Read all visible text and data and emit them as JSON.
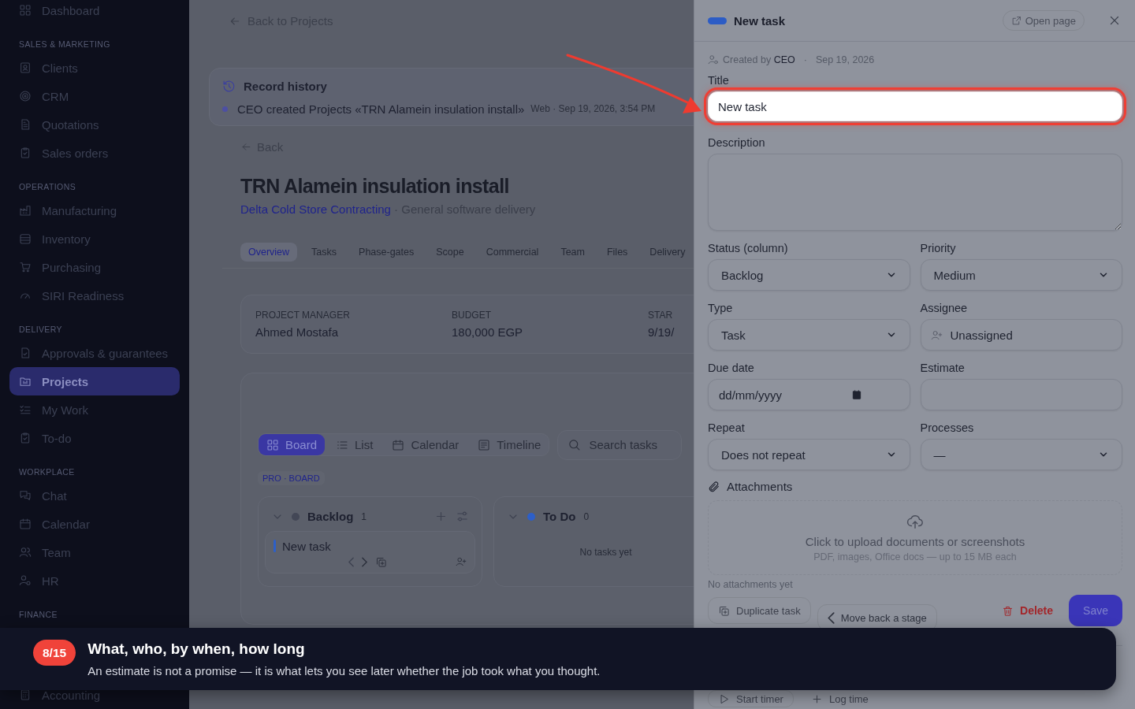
{
  "sidebar": {
    "sections": [
      {
        "items": [
          {
            "label": "Dashboard",
            "selected": false
          }
        ]
      },
      {
        "heading": "SALES & MARKETING",
        "items": [
          {
            "label": "Clients",
            "selected": false
          },
          {
            "label": "CRM",
            "selected": false
          },
          {
            "label": "Quotations",
            "selected": false
          },
          {
            "label": "Sales orders",
            "selected": false
          }
        ]
      },
      {
        "heading": "OPERATIONS",
        "items": [
          {
            "label": "Manufacturing",
            "selected": false
          },
          {
            "label": "Inventory",
            "selected": false
          },
          {
            "label": "Purchasing",
            "selected": false
          },
          {
            "label": "SIRI Readiness",
            "selected": false
          }
        ]
      },
      {
        "heading": "DELIVERY",
        "items": [
          {
            "label": "Approvals & guarantees",
            "selected": false
          },
          {
            "label": "Projects",
            "selected": true
          },
          {
            "label": "My Work",
            "selected": false
          },
          {
            "label": "To-do",
            "selected": false
          }
        ]
      },
      {
        "heading": "WORKPLACE",
        "items": [
          {
            "label": "Chat",
            "selected": false
          },
          {
            "label": "Calendar",
            "selected": false
          },
          {
            "label": "Team",
            "selected": false
          },
          {
            "label": "HR",
            "selected": false
          }
        ]
      },
      {
        "heading": "FINANCE",
        "items": [
          {
            "label": "Accounting",
            "selected": false
          }
        ]
      }
    ]
  },
  "main": {
    "back_link": "Back to Projects",
    "record_history": {
      "title": "Record history",
      "entries": [
        {
          "text": "CEO created Projects «TRN Alamein insulation install»",
          "meta": "Web · Sep 19, 2026, 3:54 PM"
        }
      ]
    },
    "back": "Back",
    "project": {
      "title": "TRN Alamein insulation install",
      "client": "Delta Cold Store Contracting",
      "subtitle": "· General software delivery"
    },
    "tabs": [
      {
        "label": "Overview",
        "selected": true
      },
      {
        "label": "Tasks",
        "selected": false
      },
      {
        "label": "Phase-gates",
        "selected": false
      },
      {
        "label": "Scope",
        "selected": false
      },
      {
        "label": "Commercial",
        "selected": false
      },
      {
        "label": "Team",
        "selected": false
      },
      {
        "label": "Files",
        "selected": false
      },
      {
        "label": "Delivery",
        "selected": false
      }
    ],
    "summary": [
      {
        "label": "PROJECT MANAGER",
        "value": "Ahmed Mostafa"
      },
      {
        "label": "BUDGET",
        "value": "180,000 EGP"
      },
      {
        "label": "STAR",
        "value": "9/19/"
      }
    ],
    "views": [
      {
        "label": "Board",
        "selected": true
      },
      {
        "label": "List",
        "selected": false
      },
      {
        "label": "Calendar",
        "selected": false
      },
      {
        "label": "Timeline",
        "selected": false
      }
    ],
    "search": {
      "placeholder": "Search tasks"
    },
    "board_tag": "PRO · BOARD",
    "columns": [
      {
        "name": "Backlog",
        "count": "1",
        "color": "#434756",
        "tasks": [
          {
            "title": "New task"
          }
        ]
      },
      {
        "name": "To Do",
        "count": "0",
        "color": "#2d5fc8",
        "empty_text": "No tasks yet"
      }
    ]
  },
  "panel": {
    "title": "New task",
    "open_page": "Open page",
    "created": "Created by **CEO**",
    "separator": "·",
    "date": "Sep 19, 2026",
    "fields": [
      {
        "kind": "text",
        "label": "Title",
        "value": "New task",
        "highlighted": true
      },
      {
        "kind": "textarea",
        "label": "Description",
        "highlighted": false
      },
      {
        "kind": "select",
        "label": "Status (column)",
        "value": "Backlog",
        "highlighted": false
      },
      {
        "kind": "select",
        "label": "Priority",
        "value": "Medium",
        "highlighted": false
      },
      {
        "kind": "select",
        "label": "Type",
        "value": "Task",
        "highlighted": false
      },
      {
        "kind": "picker",
        "label": "Assignee",
        "value": "Unassigned",
        "highlighted": false
      },
      {
        "kind": "date",
        "label": "Due date",
        "placeholder": "dd/mm/yyyy",
        "highlighted": false
      },
      {
        "kind": "text",
        "label": "Estimate",
        "highlighted": false
      },
      {
        "kind": "select",
        "label": "Repeat",
        "value": "Does not repeat",
        "highlighted": false
      },
      {
        "kind": "select",
        "label": "Processes",
        "value": "—",
        "highlighted": false
      }
    ],
    "attachments": {
      "label": "Attachments",
      "upload_text": "Click to upload documents or screenshots",
      "upload_hint": "PDF, images, Office docs — up to 15 MB each",
      "empty_text": "No attachments yet"
    },
    "actions": [
      {
        "label": "Duplicate task",
        "kind": "secondary"
      },
      {
        "label": "Move back a stage",
        "kind": "back"
      },
      {
        "label": "Delete",
        "kind": "danger"
      },
      {
        "label": "Save",
        "kind": "primary"
      }
    ],
    "time": {
      "actions": [
        {
          "label": "Start timer",
          "kind": "timer"
        },
        {
          "label": "Log time",
          "kind": "log"
        }
      ]
    }
  },
  "tour": {
    "step": "8/15",
    "title": "What, who, by when, how long",
    "text": "An estimate is not a promise — it is what lets you see later whether the job took what you thought."
  }
}
